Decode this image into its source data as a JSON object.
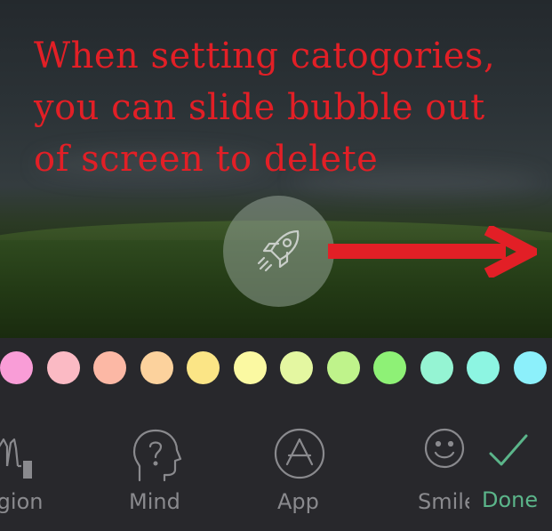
{
  "annotation": {
    "line1": "When setting catogories,",
    "line2": "you can slide bubble out",
    "line3": "of screen to delete"
  },
  "bubble": {
    "icon": "rocket-icon"
  },
  "palette": {
    "swatches": [
      "#f99dd7",
      "#fbbac4",
      "#fcb8a5",
      "#fcd29d",
      "#fbe586",
      "#fbf9a2",
      "#e4f7a1",
      "#bff38b",
      "#8ef176",
      "#95f4d3",
      "#8df5e2",
      "#8cf0fb"
    ]
  },
  "categories": [
    {
      "label": "igion",
      "icon": "praying-hands-icon"
    },
    {
      "label": "Mind",
      "icon": "head-question-icon"
    },
    {
      "label": "App",
      "icon": "app-store-icon"
    },
    {
      "label": "Smile",
      "icon": "smiley-icon"
    }
  ],
  "done": {
    "label": "Done",
    "icon": "checkmark-icon"
  },
  "colors": {
    "annotation": "#e21f26",
    "done": "#5bb58a",
    "label": "#8a8a8e",
    "tray": "#28282c"
  }
}
